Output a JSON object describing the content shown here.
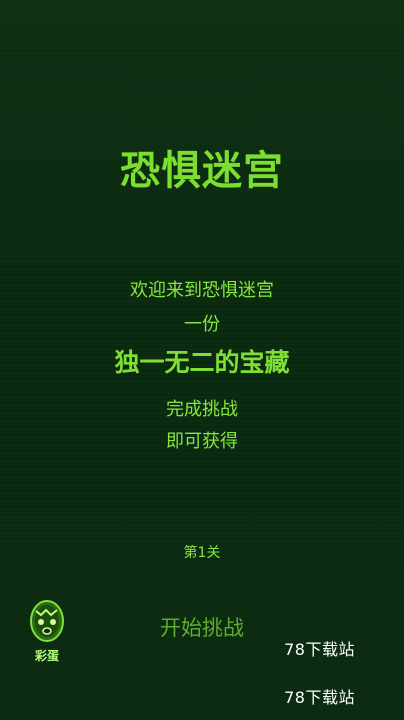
{
  "game": {
    "title": "恐惧迷宫",
    "story": [
      "欢迎来到恐惧迷宫",
      "一份",
      "独一无二的宝藏",
      "完成挑战",
      "即可获得"
    ],
    "level_label": "第1关",
    "start_button_label": "开始挑战",
    "easter_egg_label": "彩蛋",
    "watermarks": [
      "78下载站",
      "78下载站"
    ]
  },
  "colors": {
    "background": "#0b2c12",
    "title": "#7cdf2f",
    "text": "#86e83c",
    "start_button": "#5fae2a",
    "watermark": "#ffffff"
  }
}
